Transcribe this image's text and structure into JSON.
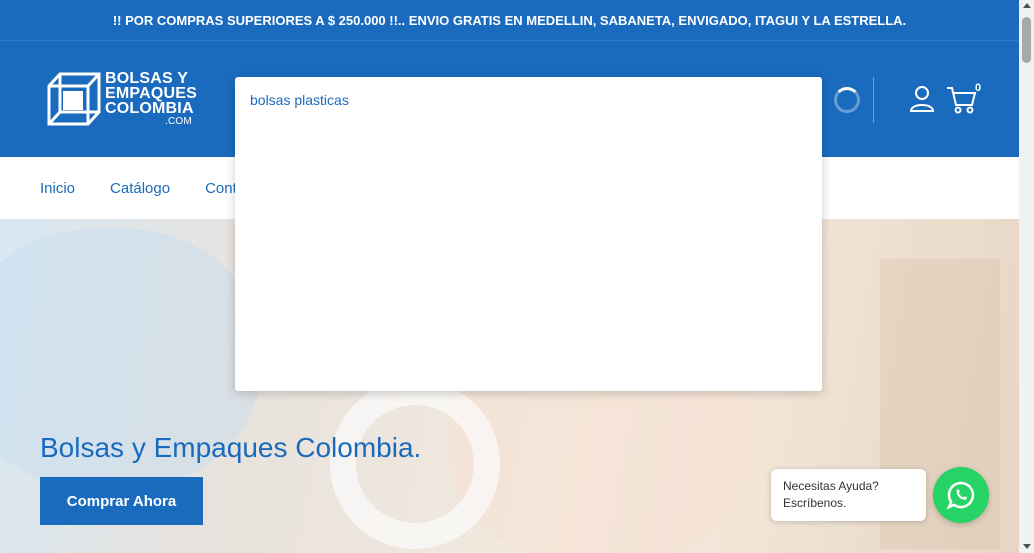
{
  "announcement": {
    "text": "!! POR COMPRAS SUPERIORES A $ 250.000 !!.. ENVIO GRATIS EN MEDELLIN, SABANETA, ENVIGADO, ITAGUI Y LA ESTRELLA."
  },
  "logo": {
    "line1": "BOLSAS Y",
    "line2": "EMPAQUES",
    "line3": "COLOMBIA",
    "line4": ".COM",
    "icon": "box-logo-icon"
  },
  "header": {
    "cart_count": "0",
    "icons": [
      "loading-spinner-icon",
      "account-icon",
      "cart-icon"
    ]
  },
  "search": {
    "value": "bolsas plasticas"
  },
  "nav": {
    "items": [
      {
        "label": "Inicio"
      },
      {
        "label": "Catálogo"
      },
      {
        "label": "Contacto"
      }
    ]
  },
  "hero": {
    "title": "Bolsas y Empaques Colombia.",
    "button_label": "Comprar Ahora"
  },
  "help": {
    "line1": "Necesitas Ayuda?",
    "line2": "Escríbenos."
  },
  "colors": {
    "brand": "#1a6bbd",
    "whatsapp": "#25d366",
    "white": "#ffffff"
  }
}
